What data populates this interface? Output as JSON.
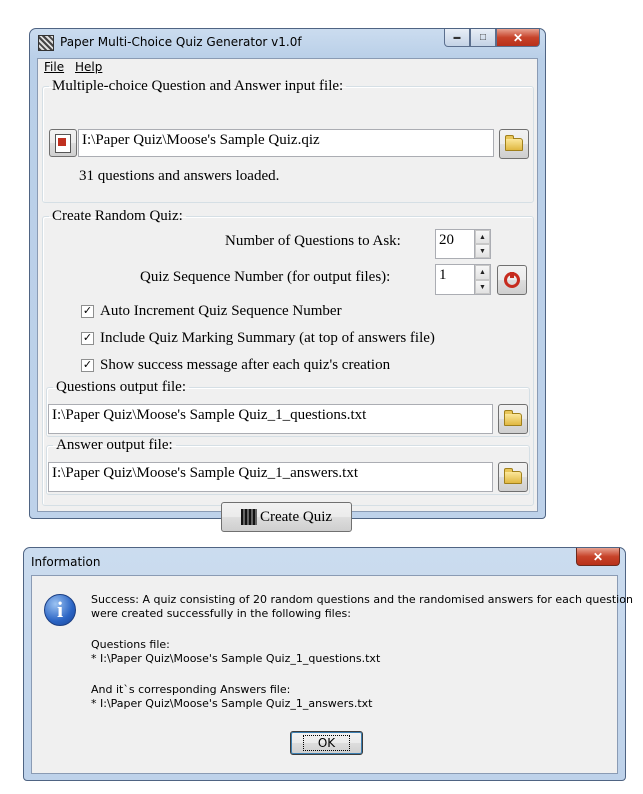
{
  "main_window": {
    "title": "Paper Multi-Choice Quiz Generator v1.0f",
    "menu": [
      {
        "label": "File"
      },
      {
        "label": "Help"
      }
    ],
    "input_group": {
      "legend": "Multiple-choice Question and Answer input file:",
      "file_path": "I:\\Paper Quiz\\Moose's Sample Quiz.qiz",
      "status": "31 questions and answers loaded."
    },
    "quiz_group": {
      "legend": "Create Random Quiz:",
      "num_questions_label": "Number of Questions to Ask:",
      "num_questions_value": "20",
      "sequence_label": "Quiz Sequence Number (for output files):",
      "sequence_value": "1",
      "checkboxes": [
        {
          "label": "Auto Increment Quiz Sequence Number",
          "checked": true
        },
        {
          "label": "Include Quiz Marking Summary (at top of answers file)",
          "checked": true
        },
        {
          "label": "Show success message after each quiz's creation",
          "checked": true
        }
      ],
      "questions_output": {
        "legend": "Questions output file:",
        "path": "I:\\Paper Quiz\\Moose's Sample Quiz_1_questions.txt"
      },
      "answer_output": {
        "legend": "Answer output file:",
        "path": "I:\\Paper Quiz\\Moose's Sample Quiz_1_answers.txt"
      },
      "create_button": "Create Quiz"
    }
  },
  "dialog": {
    "title": "Information",
    "close_glyph": "✕",
    "icon": "info-icon",
    "message_line1": "Success: A quiz consisting of 20 random questions and the randomised answers for each question",
    "message_line2": "were created successfully in the following files:",
    "questions_heading": "Questions file:",
    "questions_path": " * I:\\Paper Quiz\\Moose's Sample Quiz_1_questions.txt",
    "answers_heading": "And it`s corresponding Answers file:",
    "answers_path": " * I:\\Paper Quiz\\Moose's Sample Quiz_1_answers.txt",
    "ok_label": "OK"
  },
  "glyphs": {
    "minimize": "▬",
    "maximize": "□",
    "close": "✕",
    "spin_up": "▲",
    "spin_down": "▼",
    "check": "✓"
  }
}
